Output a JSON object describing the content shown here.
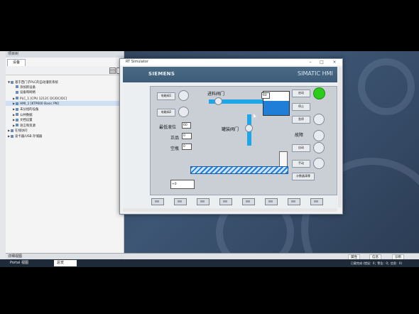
{
  "project_tree": {
    "title": "项目树",
    "tab": "设备",
    "items": [
      {
        "label": "基于西门子PLC的自动灌装系统",
        "indent": 0,
        "caret": "▼",
        "selected": false
      },
      {
        "label": "添加新设备",
        "indent": 1,
        "caret": "",
        "selected": false
      },
      {
        "label": "设备和网络",
        "indent": 1,
        "caret": "",
        "selected": false
      },
      {
        "label": "PLC_1 [CPU 1212C DC/DC/DC]",
        "indent": 1,
        "caret": "▶",
        "selected": false
      },
      {
        "label": "HMI_1 [KTP600 Basic PN]",
        "indent": 1,
        "caret": "▶",
        "selected": true
      },
      {
        "label": "未分组的设备",
        "indent": 1,
        "caret": "▶",
        "selected": false
      },
      {
        "label": "公共数据",
        "indent": 1,
        "caret": "▶",
        "selected": false
      },
      {
        "label": "文档设置",
        "indent": 1,
        "caret": "▶",
        "selected": false
      },
      {
        "label": "语言和资源",
        "indent": 1,
        "caret": "▶",
        "selected": false
      },
      {
        "label": "在线访问",
        "indent": 0,
        "caret": "▶",
        "selected": false
      },
      {
        "label": "读卡器/USB 存储器",
        "indent": 0,
        "caret": "▶",
        "selected": false
      }
    ],
    "details": "详细视图"
  },
  "simulator": {
    "title": "RT Simulator",
    "brand": "SIEMENS",
    "product": "SIMATIC HMI",
    "hmi": {
      "buttons_left": [
        "电磁阀1",
        "电磁阀2"
      ],
      "inlet_valve_label": "进料阀门",
      "inlet_value": "60",
      "bottling_valve_label": "罐装阀门",
      "level_label": "最低液位",
      "level_value": "60",
      "good_label": "正品",
      "good_value": "0",
      "empty_label": "空瓶",
      "empty_value": "0",
      "fault_label": "故障",
      "buttons_right": [
        "启动",
        "停止",
        "急停",
        "自动",
        "手动"
      ],
      "reset_button": "计数器清零",
      "bottom_io": "+0",
      "run_lamp_on": true,
      "tank_fill_percent": 60
    }
  },
  "bottom_tabs": [
    "属性",
    "信息",
    "诊断"
  ],
  "statusbar": {
    "portal": "Portal 视图",
    "overview": "总览",
    "message": "已载完成 (错误：0；警告：0；信息：0)"
  },
  "colors": {
    "accent_pipe": "#1fa6e6",
    "tank_fill": "#1f7fd8",
    "lamp_on": "#2ecc1a"
  }
}
